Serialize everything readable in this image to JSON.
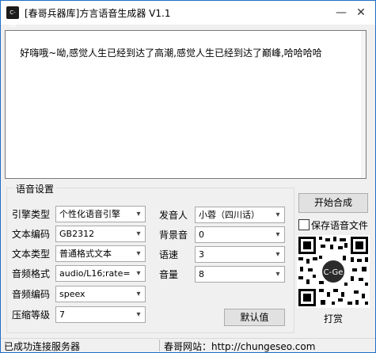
{
  "window": {
    "icon_text": "C-Ge",
    "title": "[春哥兵器库]方言语音生成器 V1.1",
    "minimize_glyph": "—",
    "close_glyph": "✕"
  },
  "text_input": {
    "value": "好嗨哦~呦,感觉人生已经到达了高潮,感觉人生已经到达了巅峰,哈哈哈哈"
  },
  "settings": {
    "group_title": "语音设置",
    "fields": {
      "engine": {
        "label": "引擎类型",
        "value": "个性化语音引擎"
      },
      "encoding": {
        "label": "文本编码",
        "value": "GB2312"
      },
      "text_type": {
        "label": "文本类型",
        "value": "普通格式文本"
      },
      "audio_format": {
        "label": "音频格式",
        "value": "audio/L16;rate="
      },
      "audio_codec": {
        "label": "音频编码",
        "value": "speex"
      },
      "compression": {
        "label": "压缩等级",
        "value": "7"
      },
      "speaker": {
        "label": "发音人",
        "value": "小蓉（四川话）"
      },
      "bg_sound": {
        "label": "背景音",
        "value": "0"
      },
      "speed": {
        "label": "语速",
        "value": "3"
      },
      "volume": {
        "label": "音量",
        "value": "8"
      }
    },
    "default_button": "默认值"
  },
  "actions": {
    "start_button": "开始合成",
    "save_checkbox_label": "保存语音文件",
    "qr_badge": "C-Ge",
    "donate_label": "打赏"
  },
  "status": {
    "left": "已成功连接服务器",
    "right": "春哥网站：http://chungeseo.com"
  },
  "colors": {
    "window_border": "#1f6fc6",
    "background": "#f0f0f0",
    "button": "#e1e1e1"
  }
}
